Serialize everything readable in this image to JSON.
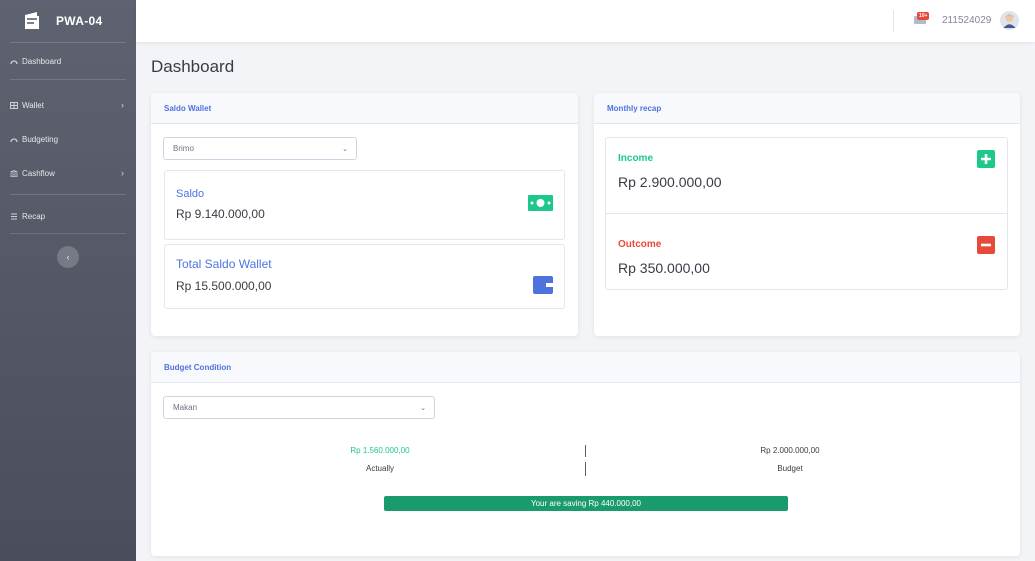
{
  "brand": {
    "name": "PWA-04"
  },
  "sidebar": {
    "items": [
      {
        "label": "Dashboard",
        "has_arrow": false
      },
      {
        "label": "Wallet",
        "has_arrow": true
      },
      {
        "label": "Budgeting",
        "has_arrow": false
      },
      {
        "label": "Cashflow",
        "has_arrow": true
      },
      {
        "label": "Recap",
        "has_arrow": false
      }
    ],
    "collapse_icon": "chevron-left-icon"
  },
  "topbar": {
    "badge": "10+",
    "username": "211524029"
  },
  "page": {
    "title": "Dashboard"
  },
  "saldo_wallet": {
    "header": "Saldo Wallet",
    "selected_wallet": "Brimo",
    "saldo_label": "Saldo",
    "saldo_value": "Rp 9.140.000,00",
    "total_label": "Total Saldo Wallet",
    "total_value": "Rp 15.500.000,00"
  },
  "monthly_recap": {
    "header": "Monthly recap",
    "income_label": "Income",
    "income_value": "Rp 2.900.000,00",
    "outcome_label": "Outcome",
    "outcome_value": "Rp 350.000,00"
  },
  "budget_condition": {
    "header": "Budget Condition",
    "selected_category": "Makan",
    "actual_value": "Rp 1.560.000,00",
    "actual_label": "Actually",
    "budget_value": "Rp 2.000.000,00",
    "budget_label": "Budget",
    "progress_text": "Your are saving Rp 440.000,00",
    "progress_fraction": 1.0
  },
  "colors": {
    "primary": "#4e73df",
    "success": "#1cc88a",
    "danger": "#e74a3b",
    "progress": "#1a9b6c"
  }
}
